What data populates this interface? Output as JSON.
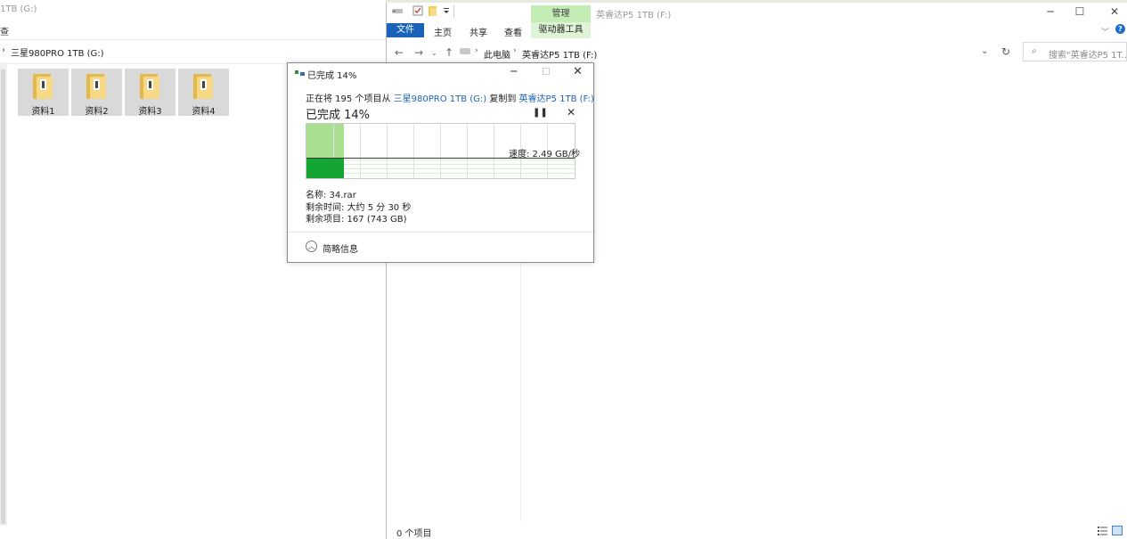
{
  "left_window": {
    "title": "1TB (G:)",
    "ribbon_fragment": "查",
    "address": "三星980PRO 1TB (G:)",
    "folders": [
      "资料1",
      "资料2",
      "资料3",
      "资料4"
    ]
  },
  "right_window": {
    "title": "英睿达P5 1TB (F:)",
    "manage_tab": "管理",
    "ribbon_tabs": {
      "file": "文件",
      "home": "主页",
      "share": "共享",
      "view": "查看",
      "drive_tools": "驱动器工具"
    },
    "breadcrumb": {
      "pc": "此电脑",
      "drive": "英睿达P5 1TB (F:)"
    },
    "search_placeholder": "搜索\"英睿达P5 1T...",
    "status": "0 个项目"
  },
  "copy_dialog": {
    "title": "已完成 14%",
    "desc_prefix": "正在将 195 个项目从 ",
    "source": "三星980PRO 1TB (G:)",
    "desc_mid": " 复制到 ",
    "destination": "英睿达P5 1TB (F:)",
    "percent_label": "已完成 14%",
    "progress_fraction": 0.14,
    "speed_label": "速度: 2.49 GB/秒",
    "name_label": "名称: 34.rar",
    "time_label": "剩余时间: 大约 5 分 30 秒",
    "items_label": "剩余项目: 167 (743 GB)",
    "less_info": "简略信息"
  },
  "colors": {
    "accent_blue": "#1a63b8",
    "link_blue": "#1a64b5",
    "progress_light_green": "#a9df91",
    "progress_dark_green": "#14a431",
    "manage_green": "#c4edb5"
  }
}
